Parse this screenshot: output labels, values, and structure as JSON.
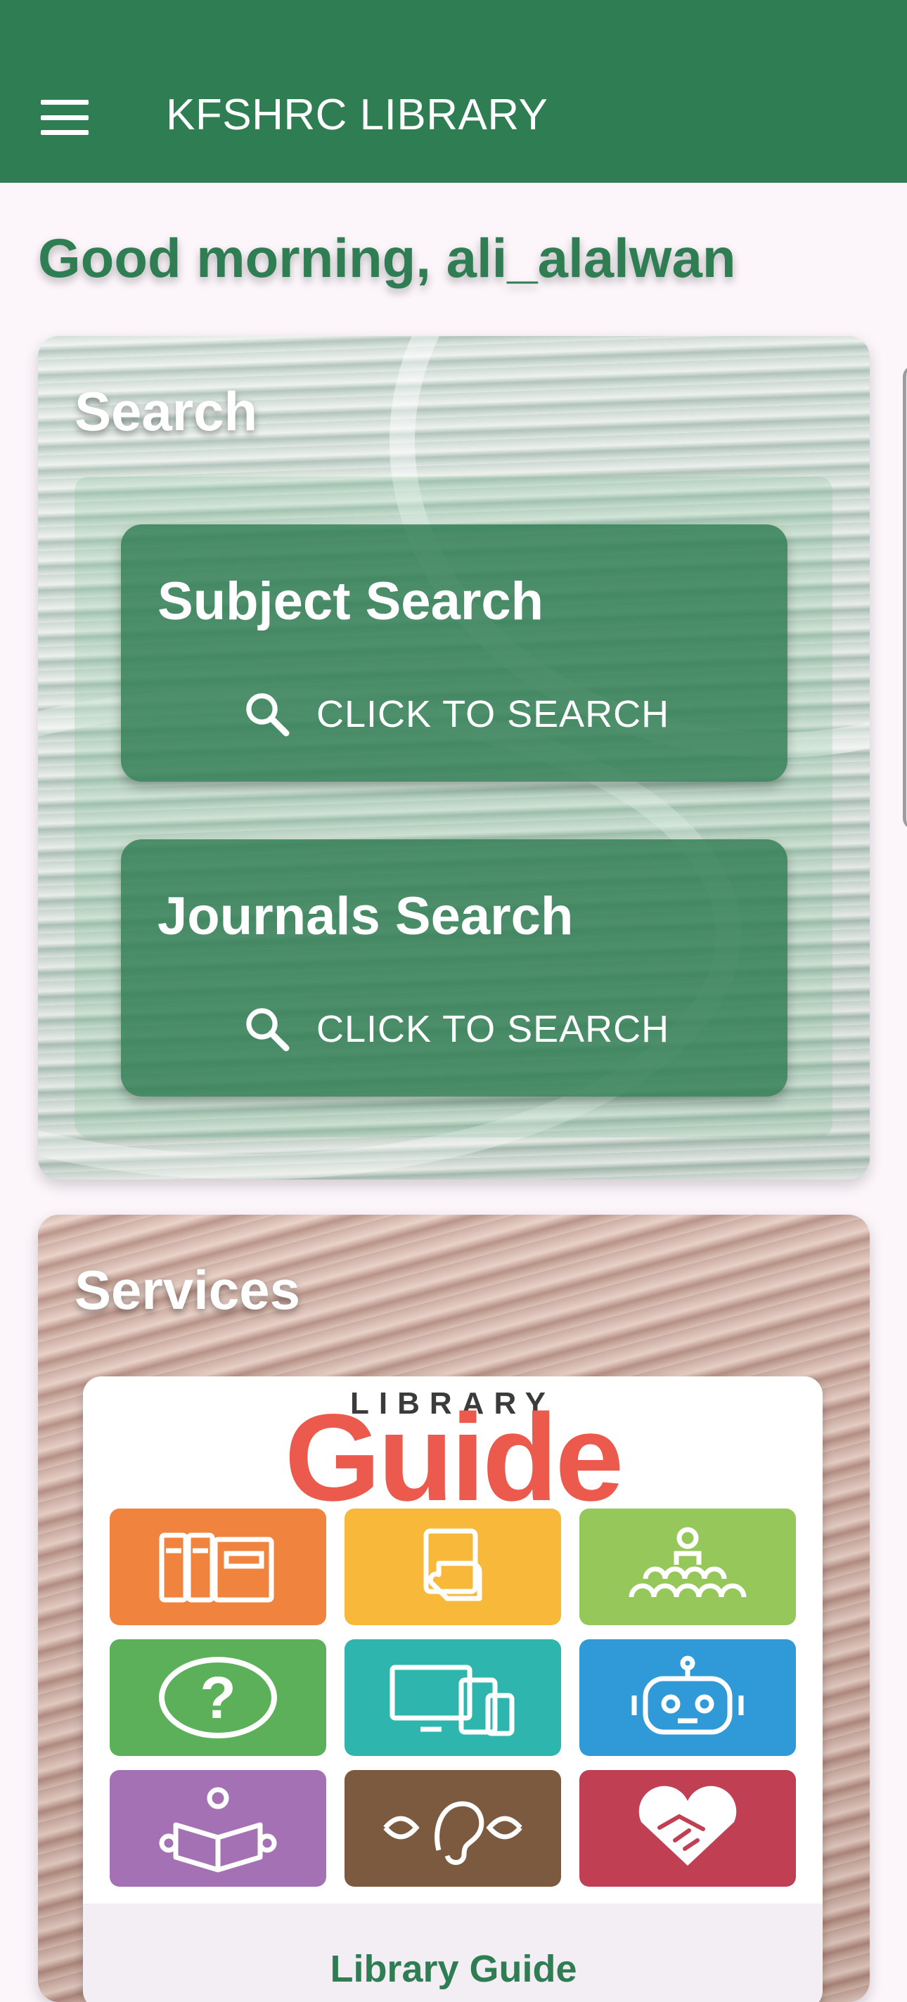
{
  "app": {
    "title": "KFSHRC LIBRARY"
  },
  "greeting": "Good morning, ali_alalwan",
  "search_section": {
    "title": "Search",
    "tiles": [
      {
        "title": "Subject Search",
        "action": "CLICK TO SEARCH"
      },
      {
        "title": "Journals Search",
        "action": "CLICK TO SEARCH"
      }
    ]
  },
  "services_section": {
    "title": "Services",
    "guide": {
      "brand_small": "LIBRARY",
      "brand_large": "Guide",
      "label": "Library Guide",
      "tiles": [
        {
          "icon": "books-icon",
          "color": "#f0843f"
        },
        {
          "icon": "document-hand-icon",
          "color": "#f8b93b"
        },
        {
          "icon": "audience-icon",
          "color": "#95c75b"
        },
        {
          "icon": "question-icon",
          "color": "#5bb059"
        },
        {
          "icon": "devices-icon",
          "color": "#2eb5ad"
        },
        {
          "icon": "robot-icon",
          "color": "#2f9ad7"
        },
        {
          "icon": "reader-icon",
          "color": "#a471b5"
        },
        {
          "icon": "eye-ear-icon",
          "color": "#7c5a40"
        },
        {
          "icon": "heart-handshake-icon",
          "color": "#c03f52"
        }
      ]
    }
  },
  "colors": {
    "primary": "#2f7d53",
    "background": "#fcf6fb"
  }
}
